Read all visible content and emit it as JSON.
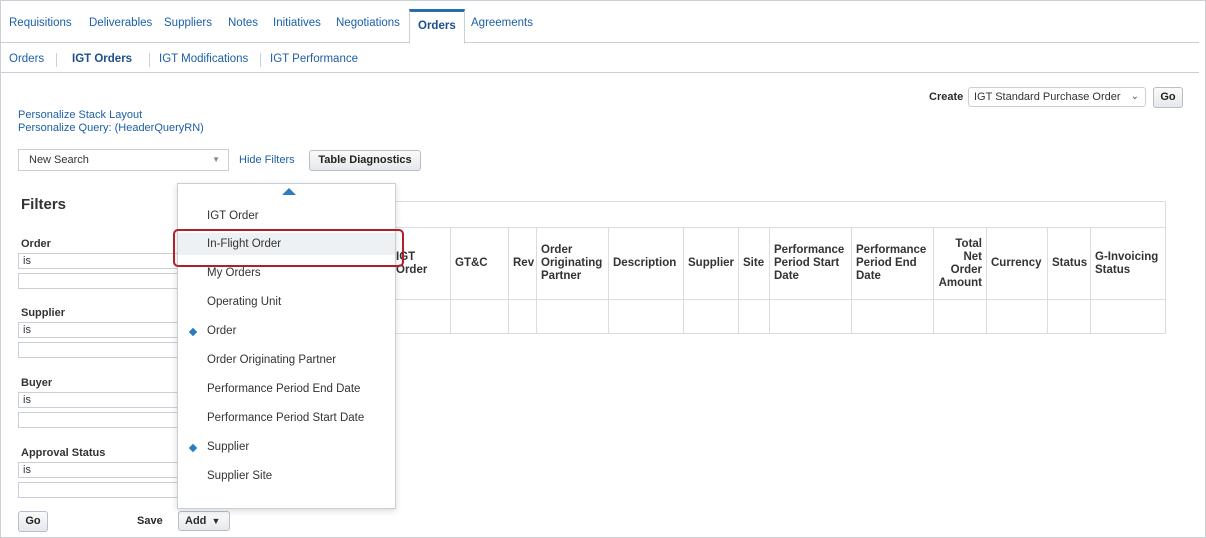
{
  "top_tabs": [
    "Requisitions",
    "Deliverables",
    "Suppliers",
    "Notes",
    "Initiatives",
    "Negotiations",
    "Orders",
    "Agreements"
  ],
  "top_tabs_active": "Orders",
  "sub_tabs": [
    "Orders",
    "IGT Orders",
    "IGT Modifications",
    "IGT Performance"
  ],
  "sub_tabs_active": "IGT Orders",
  "create": {
    "label": "Create",
    "selected": "IGT Standard Purchase Order",
    "go": "Go"
  },
  "links": {
    "personalize_stack": "Personalize Stack Layout",
    "personalize_query": "Personalize Query: (HeaderQueryRN)"
  },
  "search": {
    "selected": "New Search",
    "hide_filters": "Hide Filters",
    "table_diagnostics": "Table Diagnostics"
  },
  "filters": {
    "title": "Filters",
    "items": [
      {
        "label": "Order",
        "operator": "is"
      },
      {
        "label": "Supplier",
        "operator": "is"
      },
      {
        "label": "Buyer",
        "operator": "is"
      },
      {
        "label": "Approval Status",
        "operator": "is"
      }
    ],
    "go": "Go",
    "save": "Save",
    "add": "Add"
  },
  "table": {
    "columns": [
      "IGT Order",
      "GT&C",
      "Rev",
      "Order Originating Partner",
      "Description",
      "Supplier",
      "Site",
      "Performance Period Start Date",
      "Performance Period End Date",
      "Total Net Order Amount",
      "Currency",
      "Status",
      "G-Invoicing Status"
    ]
  },
  "menu": {
    "items": [
      {
        "label": "IGT Order",
        "selected": false
      },
      {
        "label": "In-Flight Order",
        "selected": false,
        "highlighted": true
      },
      {
        "label": "My Orders",
        "selected": false
      },
      {
        "label": "Operating Unit",
        "selected": false
      },
      {
        "label": "Order",
        "selected": true
      },
      {
        "label": "Order Originating Partner",
        "selected": false
      },
      {
        "label": "Performance Period End Date",
        "selected": false
      },
      {
        "label": "Performance Period Start Date",
        "selected": false
      },
      {
        "label": "Supplier",
        "selected": true
      },
      {
        "label": "Supplier Site",
        "selected": false
      }
    ]
  },
  "colors": {
    "link": "#1c5fa8",
    "highlight_border": "#b0202a",
    "selected_marker": "#2d7cc1"
  }
}
